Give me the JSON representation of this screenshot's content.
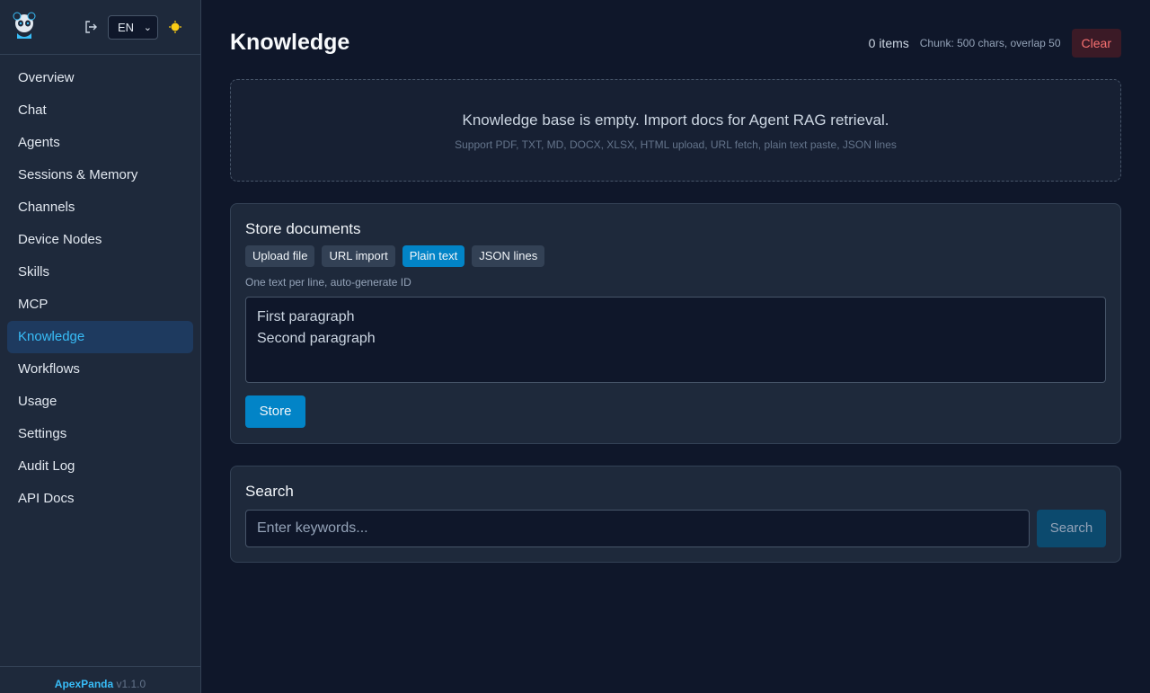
{
  "header": {
    "language": "EN"
  },
  "sidebar": {
    "items": [
      {
        "label": "Overview"
      },
      {
        "label": "Chat"
      },
      {
        "label": "Agents"
      },
      {
        "label": "Sessions & Memory"
      },
      {
        "label": "Channels"
      },
      {
        "label": "Device Nodes"
      },
      {
        "label": "Skills"
      },
      {
        "label": "MCP"
      },
      {
        "label": "Knowledge",
        "active": true
      },
      {
        "label": "Workflows"
      },
      {
        "label": "Usage"
      },
      {
        "label": "Settings"
      },
      {
        "label": "Audit Log"
      },
      {
        "label": "API Docs"
      }
    ],
    "footer": {
      "brand": "ApexPanda",
      "version": "v1.1.0"
    }
  },
  "page": {
    "title": "Knowledge",
    "item_count": "0 items",
    "chunk_info": "Chunk: 500 chars, overlap 50",
    "clear_label": "Clear"
  },
  "empty_state": {
    "title": "Knowledge base is empty. Import docs for Agent RAG retrieval.",
    "subtitle": "Support PDF, TXT, MD, DOCX, XLSX, HTML upload, URL fetch, plain text paste, JSON lines"
  },
  "store": {
    "title": "Store documents",
    "tabs": [
      {
        "label": "Upload file"
      },
      {
        "label": "URL import"
      },
      {
        "label": "Plain text",
        "active": true
      },
      {
        "label": "JSON lines"
      }
    ],
    "hint": "One text per line, auto-generate ID",
    "textarea_value": "First paragraph\nSecond paragraph",
    "button_label": "Store"
  },
  "search": {
    "title": "Search",
    "placeholder": "Enter keywords...",
    "button_label": "Search"
  },
  "colors": {
    "accent": "#0284c7",
    "active_nav_text": "#38bdf8",
    "danger": "#f87171",
    "background": "#0f172a",
    "panel": "#1e293b"
  },
  "icons": {
    "logo": "panda-logo-icon",
    "logout": "logout-icon",
    "theme": "sun-icon",
    "language_dropdown": "chevron-down-icon"
  }
}
